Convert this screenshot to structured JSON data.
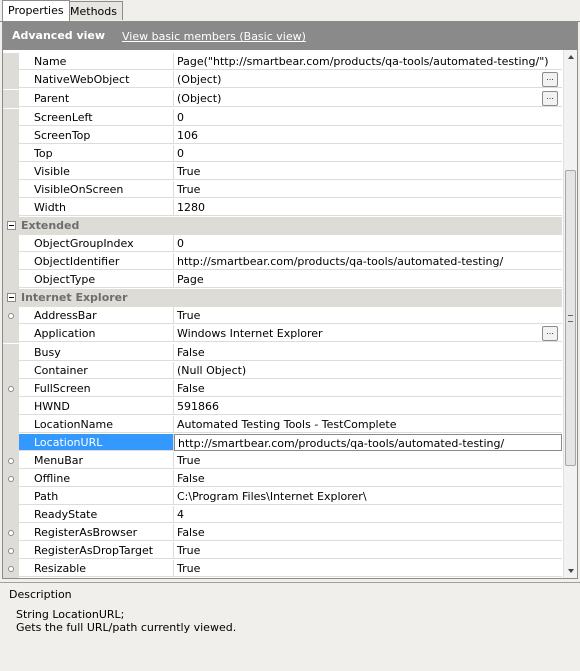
{
  "tabs": {
    "properties": "Properties",
    "methods": "Methods"
  },
  "header": {
    "title": "Advanced view",
    "link": "View basic members (Basic view)"
  },
  "ellipsis_label": "...",
  "categories": {
    "extended": "Extended",
    "ie": "Internet Explorer"
  },
  "rows": {
    "name": {
      "label": "Name",
      "value": "Page(\"http://smartbear.com/products/qa-tools/automated-testing/\")"
    },
    "nativewebobject": {
      "label": "NativeWebObject",
      "value": "(Object)"
    },
    "parent": {
      "label": "Parent",
      "value": "(Object)"
    },
    "screenleft": {
      "label": "ScreenLeft",
      "value": "0"
    },
    "screentop": {
      "label": "ScreenTop",
      "value": "106"
    },
    "top": {
      "label": "Top",
      "value": "0"
    },
    "visible": {
      "label": "Visible",
      "value": "True"
    },
    "visibleonscreen": {
      "label": "VisibleOnScreen",
      "value": "True"
    },
    "width": {
      "label": "Width",
      "value": "1280"
    },
    "objectgroupindex": {
      "label": "ObjectGroupIndex",
      "value": "0"
    },
    "objectidentifier": {
      "label": "ObjectIdentifier",
      "value": "http://smartbear.com/products/qa-tools/automated-testing/"
    },
    "objecttype": {
      "label": "ObjectType",
      "value": "Page"
    },
    "addressbar": {
      "label": "AddressBar",
      "value": "True"
    },
    "application": {
      "label": "Application",
      "value": "Windows Internet Explorer"
    },
    "busy": {
      "label": "Busy",
      "value": "False"
    },
    "container": {
      "label": "Container",
      "value": "(Null Object)"
    },
    "fullscreen": {
      "label": "FullScreen",
      "value": "False"
    },
    "hwnd": {
      "label": "HWND",
      "value": "591866"
    },
    "locationname": {
      "label": "LocationName",
      "value": "Automated Testing Tools - TestComplete"
    },
    "locationurl": {
      "label": "LocationURL",
      "value": "http://smartbear.com/products/qa-tools/automated-testing/"
    },
    "menubar": {
      "label": "MenuBar",
      "value": "True"
    },
    "offline": {
      "label": "Offline",
      "value": "False"
    },
    "path": {
      "label": "Path",
      "value": "C:\\Program Files\\Internet Explorer\\"
    },
    "readystate": {
      "label": "ReadyState",
      "value": "4"
    },
    "registerasbrowser": {
      "label": "RegisterAsBrowser",
      "value": "False"
    },
    "registerasdroptarget": {
      "label": "RegisterAsDropTarget",
      "value": "True"
    },
    "resizable": {
      "label": "Resizable",
      "value": "True"
    }
  },
  "description": {
    "title": "Description",
    "line1": "String LocationURL;",
    "line2": "Gets the full URL/path currently viewed."
  },
  "colors": {
    "header_bg": "#8a8a8a",
    "selection": "#3399ff",
    "gutter": "#dddcd7"
  },
  "icons": {
    "expand_toggle": "minus-box-icon",
    "property_marker": "circle-icon",
    "ellipsis": "ellipsis-button"
  }
}
